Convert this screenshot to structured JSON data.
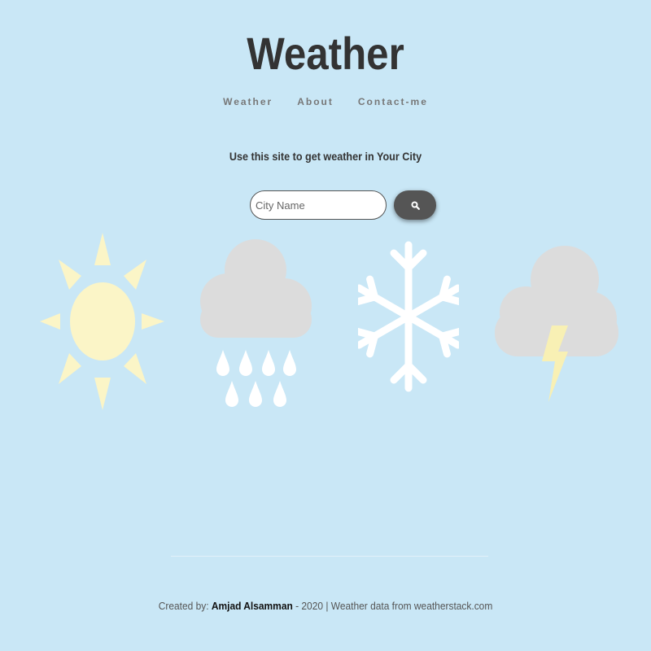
{
  "header": {
    "title": "Weather"
  },
  "nav": {
    "items": [
      {
        "label": "Weather"
      },
      {
        "label": "About"
      },
      {
        "label": "Contact-me"
      }
    ]
  },
  "main": {
    "tagline": "Use this site to get weather in Your City",
    "search": {
      "placeholder": "City Name",
      "value": "",
      "button_icon": "search-icon"
    },
    "weather_icons": [
      "sun-icon",
      "rain-cloud-icon",
      "snowflake-icon",
      "thunder-cloud-icon"
    ]
  },
  "footer": {
    "created_by_label": "Created by:",
    "author": "Amjad Alsamman",
    "rest": " - 2020 | Weather data from weatherstack.com"
  },
  "colors": {
    "background": "#c9e7f6",
    "title": "#333333",
    "nav": "#777777",
    "button": "#555555",
    "sun": "#fbf5c7",
    "cloud": "#dcdcdc",
    "snow": "#ffffff",
    "bolt": "#f8f0b4"
  }
}
